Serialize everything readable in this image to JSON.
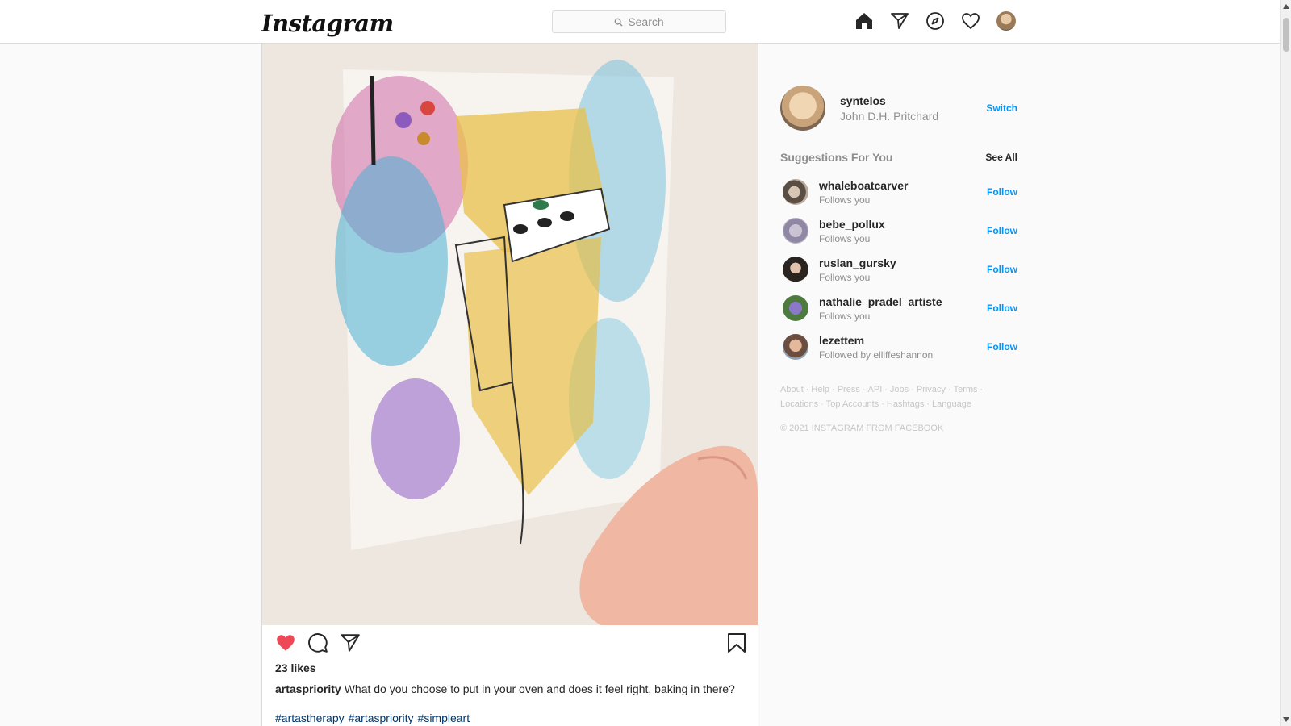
{
  "nav": {
    "logo": "Instagram",
    "search_placeholder": "Search"
  },
  "post": {
    "likes": "23 likes",
    "caption_user": "artaspriority",
    "caption_text": "What do you choose to put in your oven and does it feel right, baking in there?",
    "hashtags": [
      "#artastherapy",
      "#artaspriority",
      "#simpleart"
    ]
  },
  "sidebar": {
    "username": "syntelos",
    "full_name": "John D.H. Pritchard",
    "switch_label": "Switch",
    "suggestions_title": "Suggestions For You",
    "see_all_label": "See All",
    "suggestions": [
      {
        "user": "whaleboatcarver",
        "sub": "Follows you",
        "action": "Follow"
      },
      {
        "user": "bebe_pollux",
        "sub": "Follows you",
        "action": "Follow"
      },
      {
        "user": "ruslan_gursky",
        "sub": "Follows you",
        "action": "Follow"
      },
      {
        "user": "nathalie_pradel_artiste",
        "sub": "Follows you",
        "action": "Follow"
      },
      {
        "user": "lezettem",
        "sub": "Followed by elliffeshannon",
        "action": "Follow"
      }
    ],
    "footer_links": [
      "About",
      "Help",
      "Press",
      "API",
      "Jobs",
      "Privacy",
      "Terms",
      "Locations",
      "Top Accounts",
      "Hashtags",
      "Language"
    ],
    "copyright": "© 2021 INSTAGRAM FROM FACEBOOK"
  },
  "colors": {
    "link_blue": "#0095f6",
    "hashtag_blue": "#00376b",
    "like_red": "#ed4956",
    "muted": "#8e8e8e"
  },
  "icons": [
    "search-icon",
    "home-icon",
    "direct-icon",
    "explore-icon",
    "activity-heart-icon",
    "like-icon",
    "comment-icon",
    "share-icon",
    "save-icon"
  ]
}
